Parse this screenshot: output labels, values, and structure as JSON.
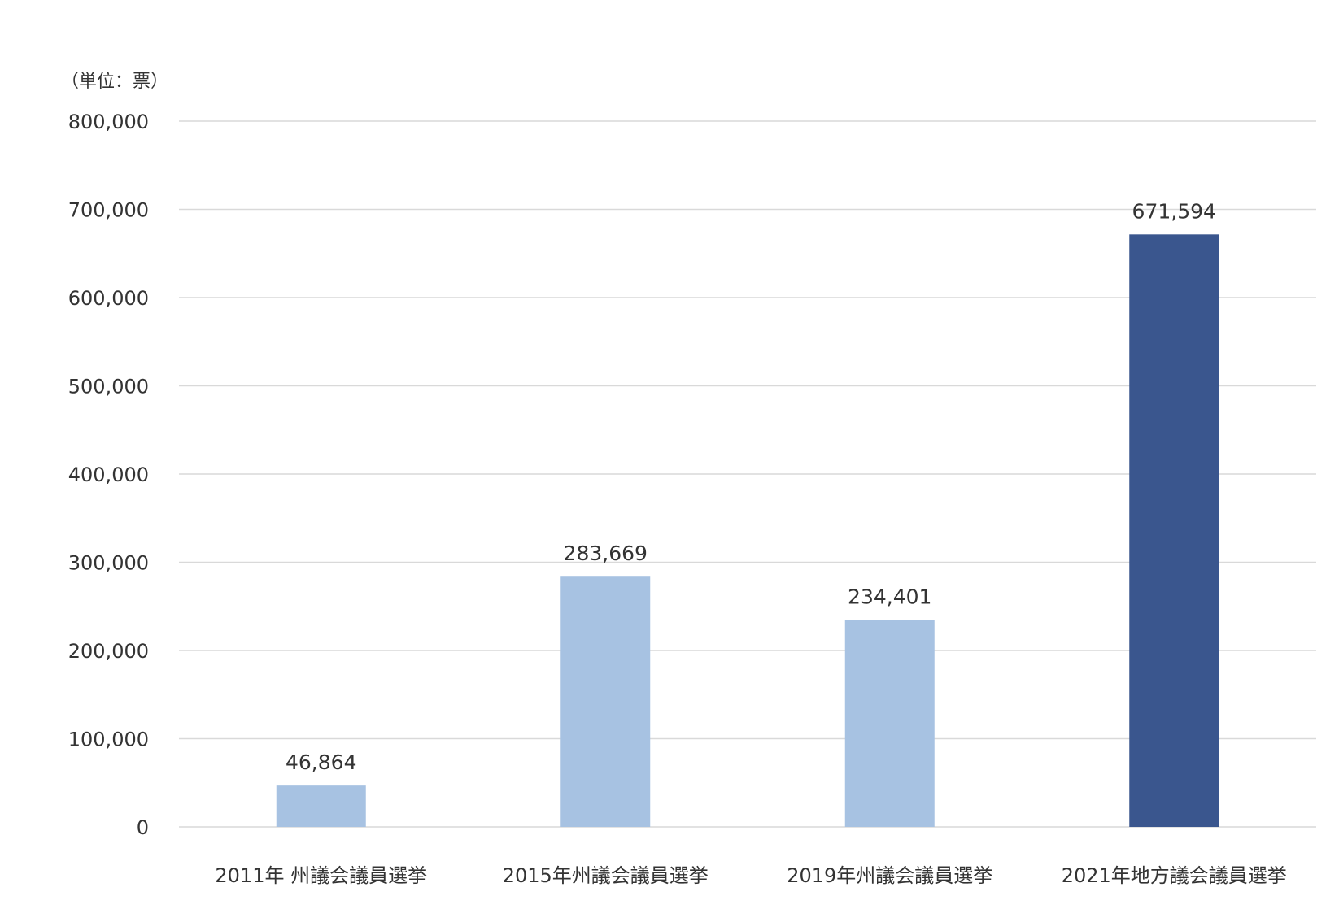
{
  "chart_data": {
    "type": "bar",
    "unit_label": "（単位：票）",
    "categories": [
      "2011年 州議会議員選挙",
      "2015年州議会議員選挙",
      "2019年州議会議員選挙",
      "2021年地方議会議員選挙"
    ],
    "values": [
      46864,
      283669,
      234401,
      671594
    ],
    "data_labels": [
      "46,864",
      "283,669",
      "234,401",
      "671,594"
    ],
    "ylim": [
      0,
      800000
    ],
    "yticks": [
      0,
      100000,
      200000,
      300000,
      400000,
      500000,
      600000,
      700000,
      800000
    ],
    "ytick_labels": [
      "0",
      "100,000",
      "200,000",
      "300,000",
      "400,000",
      "500,000",
      "600,000",
      "700,000",
      "800,000"
    ],
    "grid": true,
    "legend": "none",
    "colors": {
      "bar_default": "#a7c2e2",
      "bar_highlight": "#3a568e",
      "grid": "#d9d9d9",
      "text": "#333333"
    },
    "highlight_index": 3
  }
}
